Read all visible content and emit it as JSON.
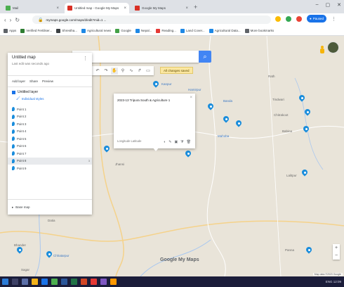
{
  "browser": {
    "tabs": [
      {
        "title": "Mail",
        "favicon_color": "#4caf50"
      },
      {
        "title": "Untitled map - Google My Maps",
        "favicon_color": "#d93025"
      },
      {
        "title": "Google My Maps",
        "favicon_color": "#d93025"
      }
    ],
    "new_tab_glyph": "+",
    "url": "mymaps.google.com/maps/d/edit?mid=1 ...",
    "profile_label": "Paused",
    "bookmarks": [
      {
        "label": "Apps",
        "color": "#5f6368"
      },
      {
        "label": "Verified Fertiliser...",
        "color": "#2e7d32"
      },
      {
        "label": "Shrestha...",
        "color": "#3c4043"
      },
      {
        "label": "Agricultural news",
        "color": "#1e88e5"
      },
      {
        "label": "Google",
        "color": "#43a047"
      },
      {
        "label": "Nepal...",
        "color": "#1e88e5"
      },
      {
        "label": "Reading...",
        "color": "#e53935"
      },
      {
        "label": "Land Cover...",
        "color": "#1e88e5"
      },
      {
        "label": "Agricultural Data...",
        "color": "#1e88e5"
      },
      {
        "label": "More bookmarks",
        "color": "#5f6368"
      }
    ]
  },
  "map_ui": {
    "search_placeholder": "",
    "unsaved_label": "All changes saved",
    "tools": [
      "undo",
      "redo",
      "select",
      "add-marker",
      "draw-line",
      "add-directions",
      "measure"
    ]
  },
  "panel": {
    "title": "Untitled map",
    "subtitle": "Last edit was seconds ago",
    "actions": [
      "Add layer",
      "Share",
      "Preview"
    ],
    "layer_name": "Untitled layer",
    "layer_style": "Individual styles",
    "features": [
      "Point 1",
      "Point 2",
      "Point 3",
      "Point 4",
      "Point 5",
      "Point 6",
      "Point 7",
      "Point 8",
      "Point 9"
    ],
    "selected_badge": "3",
    "basemap_label": "Base map"
  },
  "popup": {
    "title": "2023-13 Tripura South & Agriculture 1",
    "coords": "Longitude Latitude",
    "actions": [
      "style-icon",
      "edit-icon",
      "camera-icon",
      "filter-icon",
      "delete-icon"
    ]
  },
  "places": [
    {
      "label": "Kanpur"
    },
    {
      "label": "Hamirpur"
    },
    {
      "label": "Banda"
    },
    {
      "label": "Mahoba"
    },
    {
      "label": "Rath"
    },
    {
      "label": "Tindwari"
    },
    {
      "label": "Chitrakoot"
    },
    {
      "label": "Babina"
    },
    {
      "label": "Jhansi"
    },
    {
      "label": "Lalitpur"
    },
    {
      "label": "Datia"
    },
    {
      "label": "Bhander"
    },
    {
      "label": "Chhatarpur"
    },
    {
      "label": "Panna"
    },
    {
      "label": "Sagar"
    }
  ],
  "map_controls": {
    "zoom_in": "+",
    "zoom_out": "−"
  },
  "google_logo": "Google My Maps",
  "attribution": "Map data ©2023 Google",
  "taskbar": {
    "tray_text": "ENG 12:09"
  }
}
